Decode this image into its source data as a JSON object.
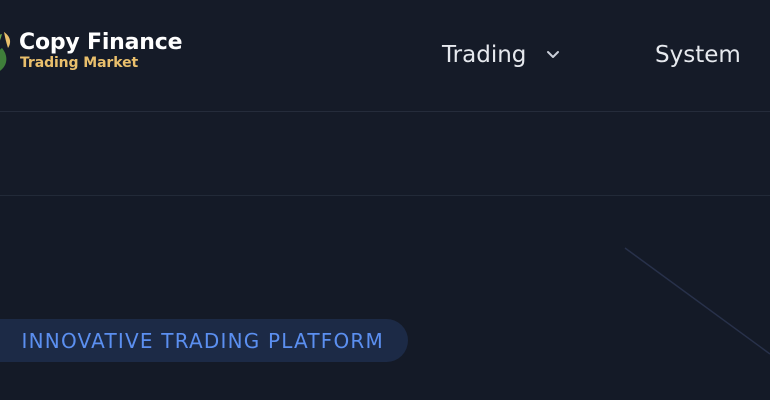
{
  "header": {
    "logo": {
      "title": "Copy Finance",
      "subtitle": "Trading Market",
      "icon": "leaf-logo-icon"
    },
    "nav": [
      {
        "label": "Trading",
        "has_dropdown": true,
        "icon": "chevron-down-icon"
      },
      {
        "label": "System",
        "has_dropdown": false
      }
    ]
  },
  "hero": {
    "badge_text": "INNOVATIVE TRADING PLATFORM"
  },
  "colors": {
    "background": "#141a27",
    "brand_gold": "#e9bf6c",
    "brand_green": "#6aa84f",
    "badge_text": "#5b8ff0",
    "badge_bg": "#1c2a46",
    "nav_text": "#e6e9ee"
  }
}
